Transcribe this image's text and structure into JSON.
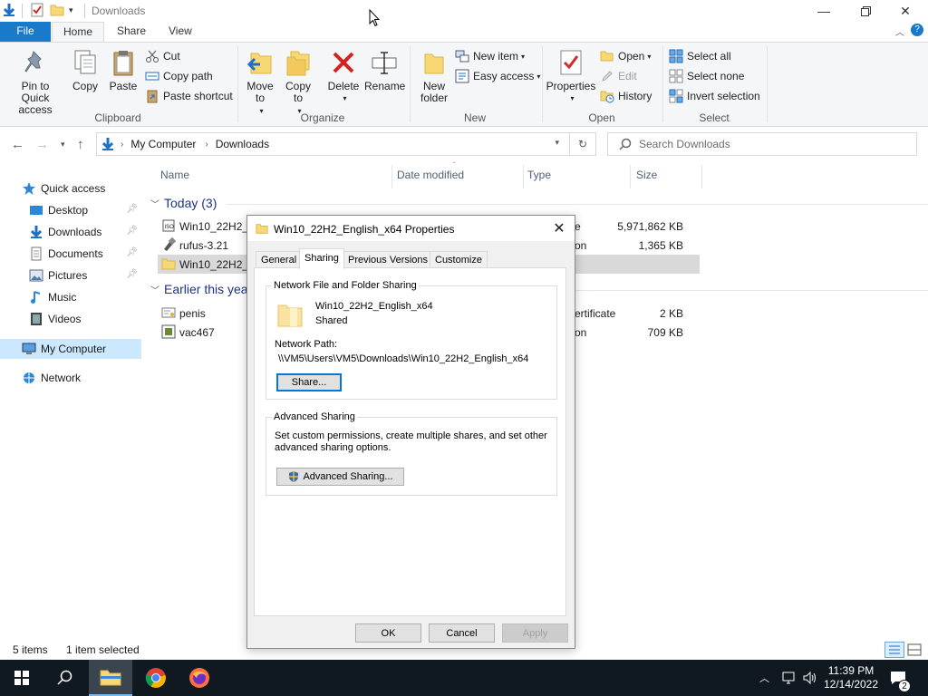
{
  "window": {
    "title": "Downloads",
    "minimize_icon": "minimize-icon",
    "maximize_icon": "restore-icon",
    "close_icon": "close-icon"
  },
  "ribbon_tabs": [
    "File",
    "Home",
    "Share",
    "View"
  ],
  "ribbon": {
    "clipboard": {
      "label": "Clipboard",
      "pin": "Pin to Quick access",
      "copy": "Copy",
      "paste": "Paste",
      "cut": "Cut",
      "copy_path": "Copy path",
      "paste_shortcut": "Paste shortcut"
    },
    "organize": {
      "label": "Organize",
      "move_to": "Move to",
      "copy_to": "Copy to",
      "delete": "Delete",
      "rename": "Rename"
    },
    "new": {
      "label": "New",
      "new_folder": "New folder",
      "new_item": "New item",
      "easy_access": "Easy access"
    },
    "open": {
      "label": "Open",
      "properties": "Properties",
      "open": "Open",
      "edit": "Edit",
      "history": "History"
    },
    "select": {
      "label": "Select",
      "select_all": "Select all",
      "select_none": "Select none",
      "invert_selection": "Invert selection"
    }
  },
  "address": {
    "crumbs": [
      "My Computer",
      "Downloads"
    ],
    "search_placeholder": "Search Downloads"
  },
  "nav": {
    "quick_access": "Quick access",
    "items": [
      {
        "label": "Desktop",
        "icon": "desktop-icon",
        "pinned": true
      },
      {
        "label": "Downloads",
        "icon": "downloads-icon",
        "pinned": true
      },
      {
        "label": "Documents",
        "icon": "documents-icon",
        "pinned": true
      },
      {
        "label": "Pictures",
        "icon": "pictures-icon",
        "pinned": true
      },
      {
        "label": "Music",
        "icon": "music-icon",
        "pinned": false
      },
      {
        "label": "Videos",
        "icon": "videos-icon",
        "pinned": false
      }
    ],
    "my_computer": "My Computer",
    "network": "Network"
  },
  "columns": {
    "name": "Name",
    "date_modified": "Date modified",
    "type": "Type",
    "size": "Size"
  },
  "groups": {
    "today": "Today (3)",
    "earlier": "Earlier this yea"
  },
  "files_today": [
    {
      "name": "Win10_22H2_E",
      "type": "e",
      "size": "5,971,862 KB",
      "icon": "disc-image-icon"
    },
    {
      "name": "rufus-3.21",
      "type": "on",
      "size": "1,365 KB",
      "icon": "usb-app-icon"
    },
    {
      "name": "Win10_22H2_E",
      "type": "",
      "size": "",
      "icon": "folder-icon",
      "selected": true
    }
  ],
  "files_earlier": [
    {
      "name": "penis",
      "type": "ertificate",
      "size": "2 KB",
      "icon": "certificate-icon"
    },
    {
      "name": "vac467",
      "type": "on",
      "size": "709 KB",
      "icon": "app-icon"
    }
  ],
  "status": {
    "items": "5 items",
    "selected": "1 item selected"
  },
  "dialog": {
    "title": "Win10_22H2_English_x64 Properties",
    "tabs": [
      "General",
      "Sharing",
      "Previous Versions",
      "Customize"
    ],
    "active_tab": "Sharing",
    "network_sharing": {
      "heading": "Network File and Folder Sharing",
      "folder_name": "Win10_22H2_English_x64",
      "status": "Shared",
      "path_label": "Network Path:",
      "path": "\\\\VM5\\Users\\VM5\\Downloads\\Win10_22H2_English_x64",
      "share_button": "Share..."
    },
    "advanced_sharing": {
      "heading": "Advanced Sharing",
      "description_line1": "Set custom permissions, create multiple shares, and set other",
      "description_line2": "advanced sharing options.",
      "button": "Advanced Sharing..."
    },
    "ok": "OK",
    "cancel": "Cancel",
    "apply": "Apply"
  },
  "taskbar": {
    "apps": [
      "start-icon",
      "search-icon",
      "file-explorer-icon",
      "chrome-icon",
      "firefox-icon"
    ],
    "time": "11:39 PM",
    "date": "12/14/2022",
    "notification_count": "2"
  }
}
